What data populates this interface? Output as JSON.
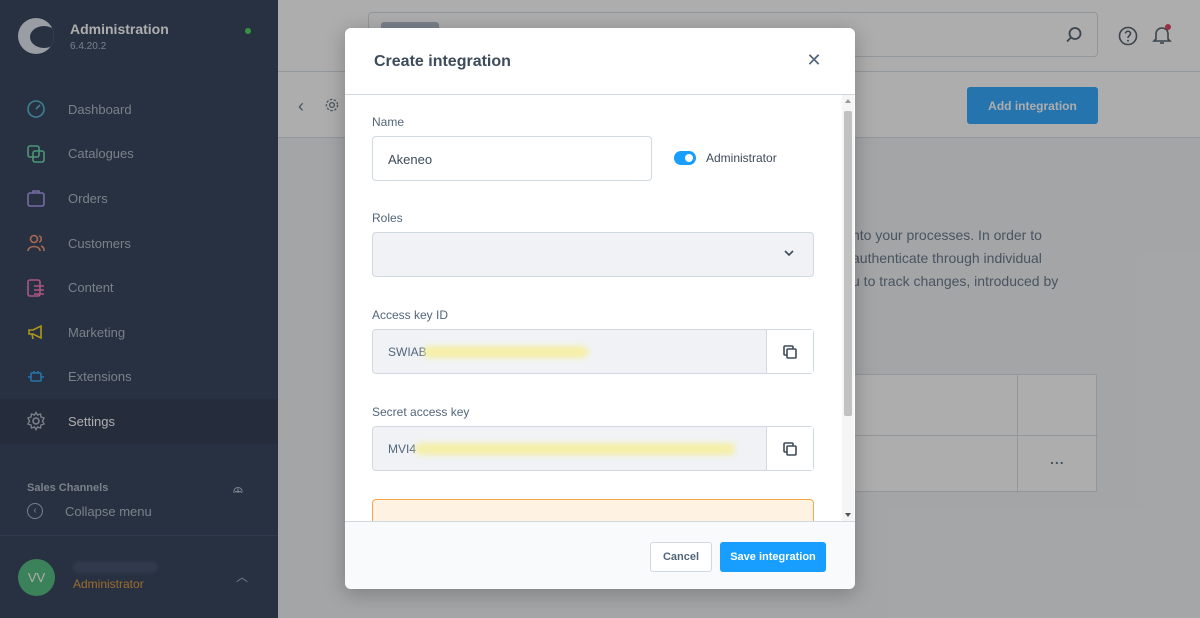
{
  "app": {
    "title": "Administration",
    "version": "6.4.20.2"
  },
  "sidebar": {
    "items": [
      {
        "label": "Dashboard",
        "icon": "dashboard-icon",
        "color": "#3fb1cf"
      },
      {
        "label": "Catalogues",
        "icon": "catalogue-icon",
        "color": "#57d9a3"
      },
      {
        "label": "Orders",
        "icon": "orders-icon",
        "color": "#a092f0"
      },
      {
        "label": "Customers",
        "icon": "customers-icon",
        "color": "#f88962"
      },
      {
        "label": "Content",
        "icon": "content-icon",
        "color": "#ff68b4"
      },
      {
        "label": "Marketing",
        "icon": "marketing-icon",
        "color": "#ffd700"
      },
      {
        "label": "Extensions",
        "icon": "extensions-icon",
        "color": "#189eff"
      },
      {
        "label": "Settings",
        "icon": "gear-icon",
        "color": "#a7b3c3"
      }
    ],
    "sales_channels_label": "Sales Channels",
    "collapse_label": "Collapse menu",
    "user": {
      "initials": "VV",
      "role": "Administrator"
    }
  },
  "header": {
    "add_integration_label": "Add integration"
  },
  "background": {
    "description_lines": [
      "nto your processes. In order to",
      "authenticate through individual",
      "u to track changes, introduced by"
    ],
    "row_actions": "..."
  },
  "modal": {
    "title": "Create integration",
    "name_label": "Name",
    "name_value": "Akeneo",
    "admin_toggle_label": "Administrator",
    "admin_toggle_on": true,
    "roles_label": "Roles",
    "access_key_label": "Access key ID",
    "access_key_value": "SWIAB",
    "secret_key_label": "Secret access key",
    "secret_key_value": "MVI4",
    "cancel_label": "Cancel",
    "save_label": "Save integration"
  },
  "colors": {
    "primary": "#189eff",
    "sidebar_bg": "#1a2a45",
    "warning_border": "#f7a84b",
    "role_text": "#e38f26"
  }
}
